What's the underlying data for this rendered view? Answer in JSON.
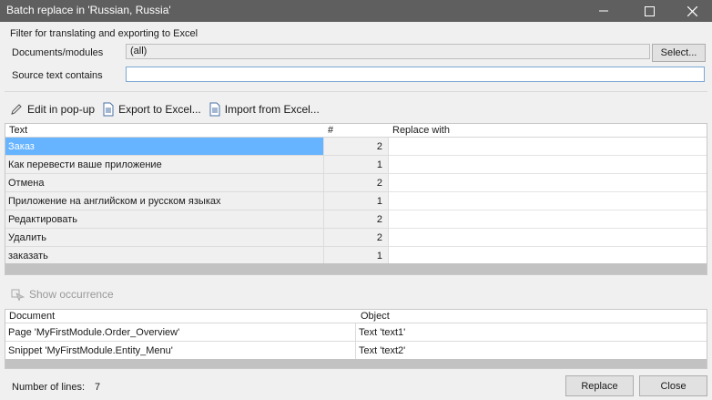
{
  "window": {
    "title": "Batch replace in 'Russian, Russia'"
  },
  "filter": {
    "group_title": "Filter for translating and exporting to Excel",
    "documents_label": "Documents/modules",
    "documents_value": "(all)",
    "select_label": "Select...",
    "source_label": "Source text contains",
    "source_value": ""
  },
  "toolbar": {
    "edit_label": "Edit in pop-up",
    "export_label": "Export to Excel...",
    "import_label": "Import from Excel..."
  },
  "texts_table": {
    "headers": {
      "text": "Text",
      "count": "#",
      "replace": "Replace with"
    },
    "rows": [
      {
        "text": "Заказ",
        "count": "2",
        "replace": ""
      },
      {
        "text": "Как перевести ваше приложение",
        "count": "1",
        "replace": ""
      },
      {
        "text": "Отмена",
        "count": "2",
        "replace": ""
      },
      {
        "text": "Приложение на английском и русском языках",
        "count": "1",
        "replace": ""
      },
      {
        "text": "Редактировать",
        "count": "2",
        "replace": ""
      },
      {
        "text": "Удалить",
        "count": "2",
        "replace": ""
      },
      {
        "text": "заказать",
        "count": "1",
        "replace": ""
      }
    ],
    "selected_index": 0
  },
  "occurrence": {
    "show_label": "Show occurrence"
  },
  "occ_table": {
    "headers": {
      "document": "Document",
      "object": "Object"
    },
    "rows": [
      {
        "document": "Page 'MyFirstModule.Order_Overview'",
        "object": "Text 'text1'"
      },
      {
        "document": "Snippet 'MyFirstModule.Entity_Menu'",
        "object": "Text 'text2'"
      }
    ]
  },
  "footer": {
    "lines_label": "Number of lines:",
    "lines_count": "7",
    "replace_label": "Replace",
    "close_label": "Close"
  }
}
